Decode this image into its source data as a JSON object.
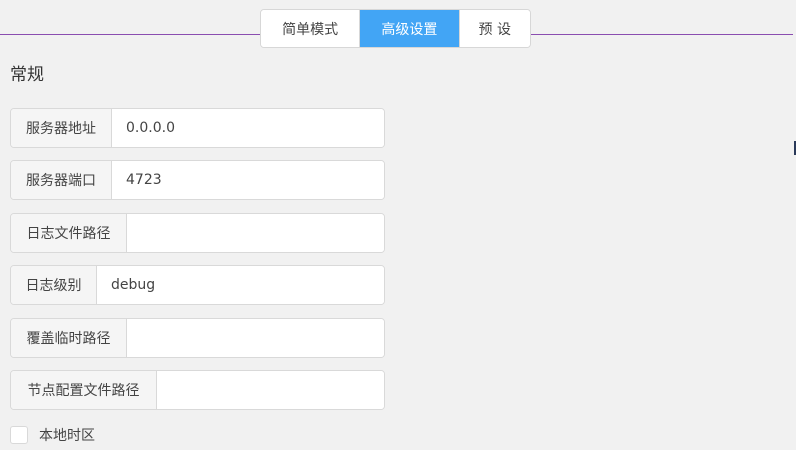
{
  "tabs": [
    {
      "label": "简单模式",
      "active": false
    },
    {
      "label": "高级设置",
      "active": true
    },
    {
      "label": "预 设",
      "active": false
    }
  ],
  "section": {
    "title": "常规"
  },
  "fields": [
    {
      "label": "服务器地址",
      "value": "0.0.0.0",
      "placeholder": ""
    },
    {
      "label": "服务器端口",
      "value": "4723",
      "placeholder": ""
    },
    {
      "label": "日志文件路径",
      "value": "",
      "placeholder": ""
    },
    {
      "label": "日志级别",
      "value": "debug",
      "placeholder": ""
    },
    {
      "label": "覆盖临时路径",
      "value": "",
      "placeholder": ""
    },
    {
      "label": "节点配置文件路径",
      "value": "",
      "placeholder": ""
    }
  ],
  "checkbox": {
    "label": "本地时区",
    "checked": false
  },
  "colors": {
    "accent": "#42a5f5",
    "divider": "#8a4db0",
    "background": "#f1f1f1"
  }
}
